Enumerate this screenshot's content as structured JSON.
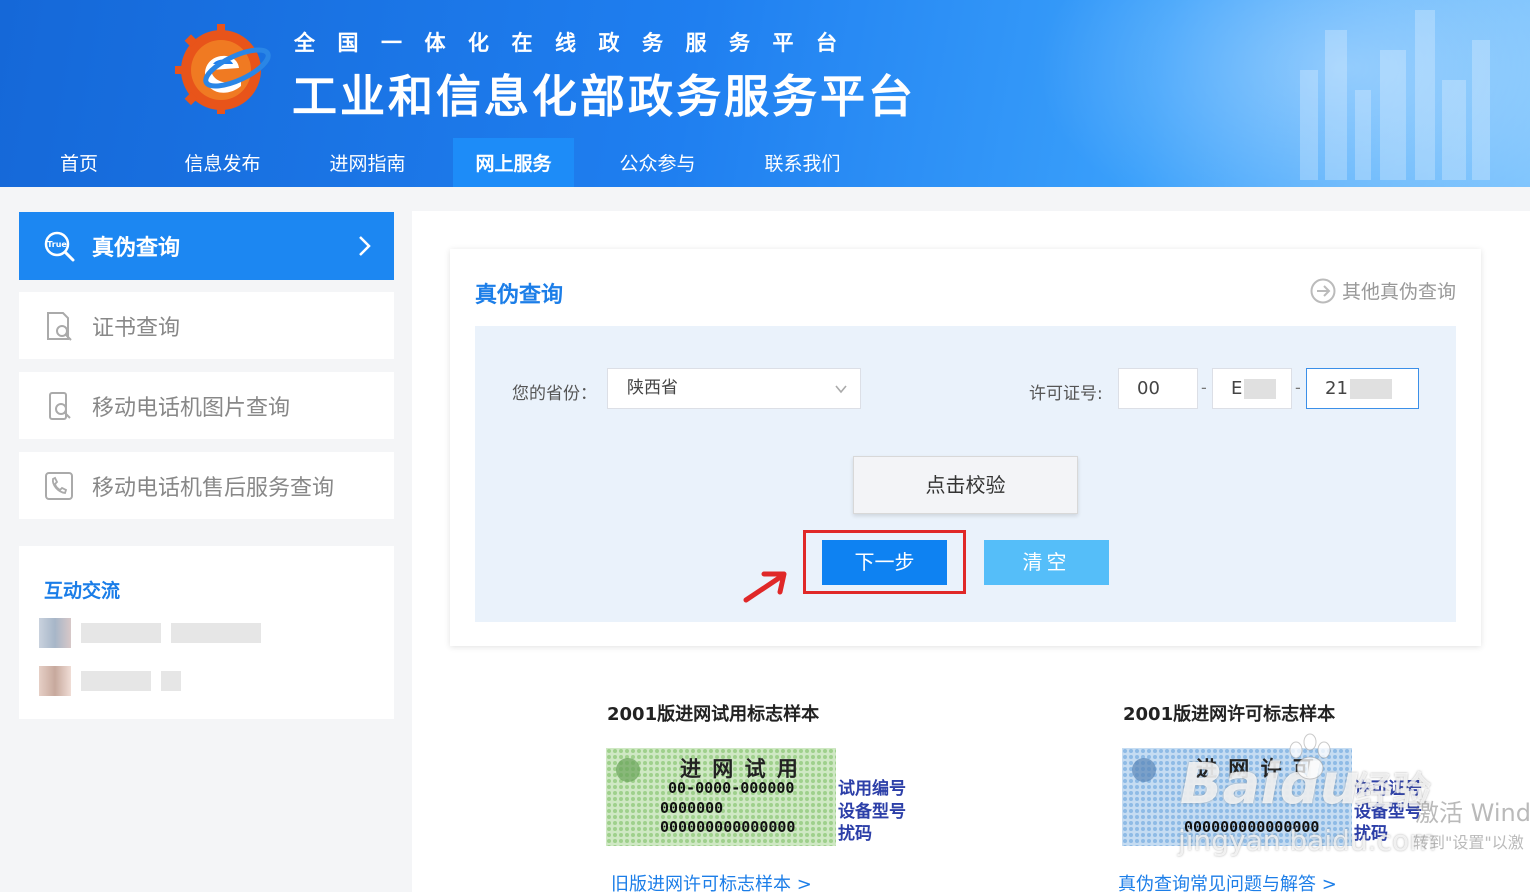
{
  "header": {
    "subtitle": "全国一体化在线政务服务平台",
    "title": "工业和信息化部政务服务平台"
  },
  "nav": {
    "items": [
      {
        "label": "首页"
      },
      {
        "label": "信息发布"
      },
      {
        "label": "进网指南"
      },
      {
        "label": "网上服务",
        "active": true
      },
      {
        "label": "公众参与"
      },
      {
        "label": "联系我们"
      }
    ]
  },
  "sidebar": {
    "items": [
      {
        "label": "真伪查询",
        "icon": "true-search-icon",
        "active": true
      },
      {
        "label": "证书查询",
        "icon": "certificate-search-icon"
      },
      {
        "label": "移动电话机图片查询",
        "icon": "phone-image-search-icon"
      },
      {
        "label": "移动电话机售后服务查询",
        "icon": "phone-service-icon"
      }
    ],
    "interaction": {
      "title": "互动交流"
    }
  },
  "main": {
    "card_title": "真伪查询",
    "other_link": "其他真伪查询",
    "province_label": "您的省份：",
    "province_value": "陕西省",
    "license_label": "许可证号:",
    "license_part1": "00",
    "license_part2": "E",
    "license_part3": "21",
    "dash": "-",
    "verify_button": "点击校验",
    "next_button": "下一步",
    "clear_button": "清空"
  },
  "samples": {
    "left_title": "2001版进网试用标志样本",
    "right_title": "2001版进网许可标志样本",
    "left_link": "旧版进网许可标志样本 >",
    "right_link": "真伪查询常见问题与解答 >",
    "left_label_top": "进 网 试 用",
    "left_code_1": "00-0000-000000",
    "left_code_2": "0000000",
    "left_code_3": "000000000000000",
    "left_anno_1": "试用编号",
    "left_anno_2": "设备型号",
    "left_anno_3": "扰码",
    "right_label_top": "进 网 许 可",
    "right_code_3": "000000000000000",
    "right_anno_1": "许可证号",
    "right_anno_2": "设备型号",
    "right_anno_3": "扰码"
  },
  "watermark": {
    "brand": "Bai",
    "brand_suffix": "du",
    "cn": "经验",
    "url": "jingyan.baidu.com"
  },
  "windows_notice": {
    "line1": "激活 Wind",
    "line2": "转到\"设置\"以激"
  },
  "colors": {
    "primary": "#1c87f2",
    "next_button": "#0e82f2",
    "clear_button": "#55bef9",
    "highlight": "#e02828",
    "form_bg": "#eaf2fb"
  }
}
